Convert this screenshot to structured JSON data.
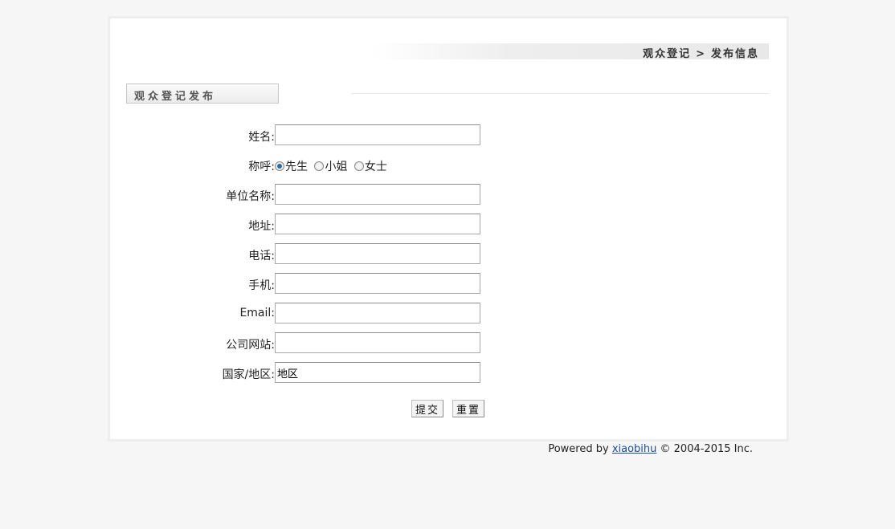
{
  "breadcrumb": {
    "parent": "观众登记",
    "separator": ">",
    "current": "发布信息"
  },
  "section": {
    "title": "观众登记发布"
  },
  "form": {
    "name_label": "姓名:",
    "name_value": "",
    "salutation_label": "称呼:",
    "salutation_options": [
      "先生",
      "小姐",
      "女士"
    ],
    "salutation_selected": "先生",
    "company_label": "单位名称:",
    "company_value": "",
    "address_label": "地址:",
    "address_value": "",
    "phone_label": "电话:",
    "phone_value": "",
    "mobile_label": "手机:",
    "mobile_value": "",
    "email_label": "Email:",
    "email_value": "",
    "website_label": "公司网站:",
    "website_value": "",
    "region_label": "国家/地区:",
    "region_value": "地区",
    "submit_label": "提交",
    "reset_label": "重置"
  },
  "footer": {
    "prefix": "Powered by ",
    "link_text": "xiaobihu",
    "suffix": " © 2004-2015 Inc."
  },
  "colors": {
    "page_bg": "#f6f6f6",
    "panel_bg": "#ffffff",
    "link": "#1a4fa0",
    "radio_checked": "#2b6c9e"
  }
}
